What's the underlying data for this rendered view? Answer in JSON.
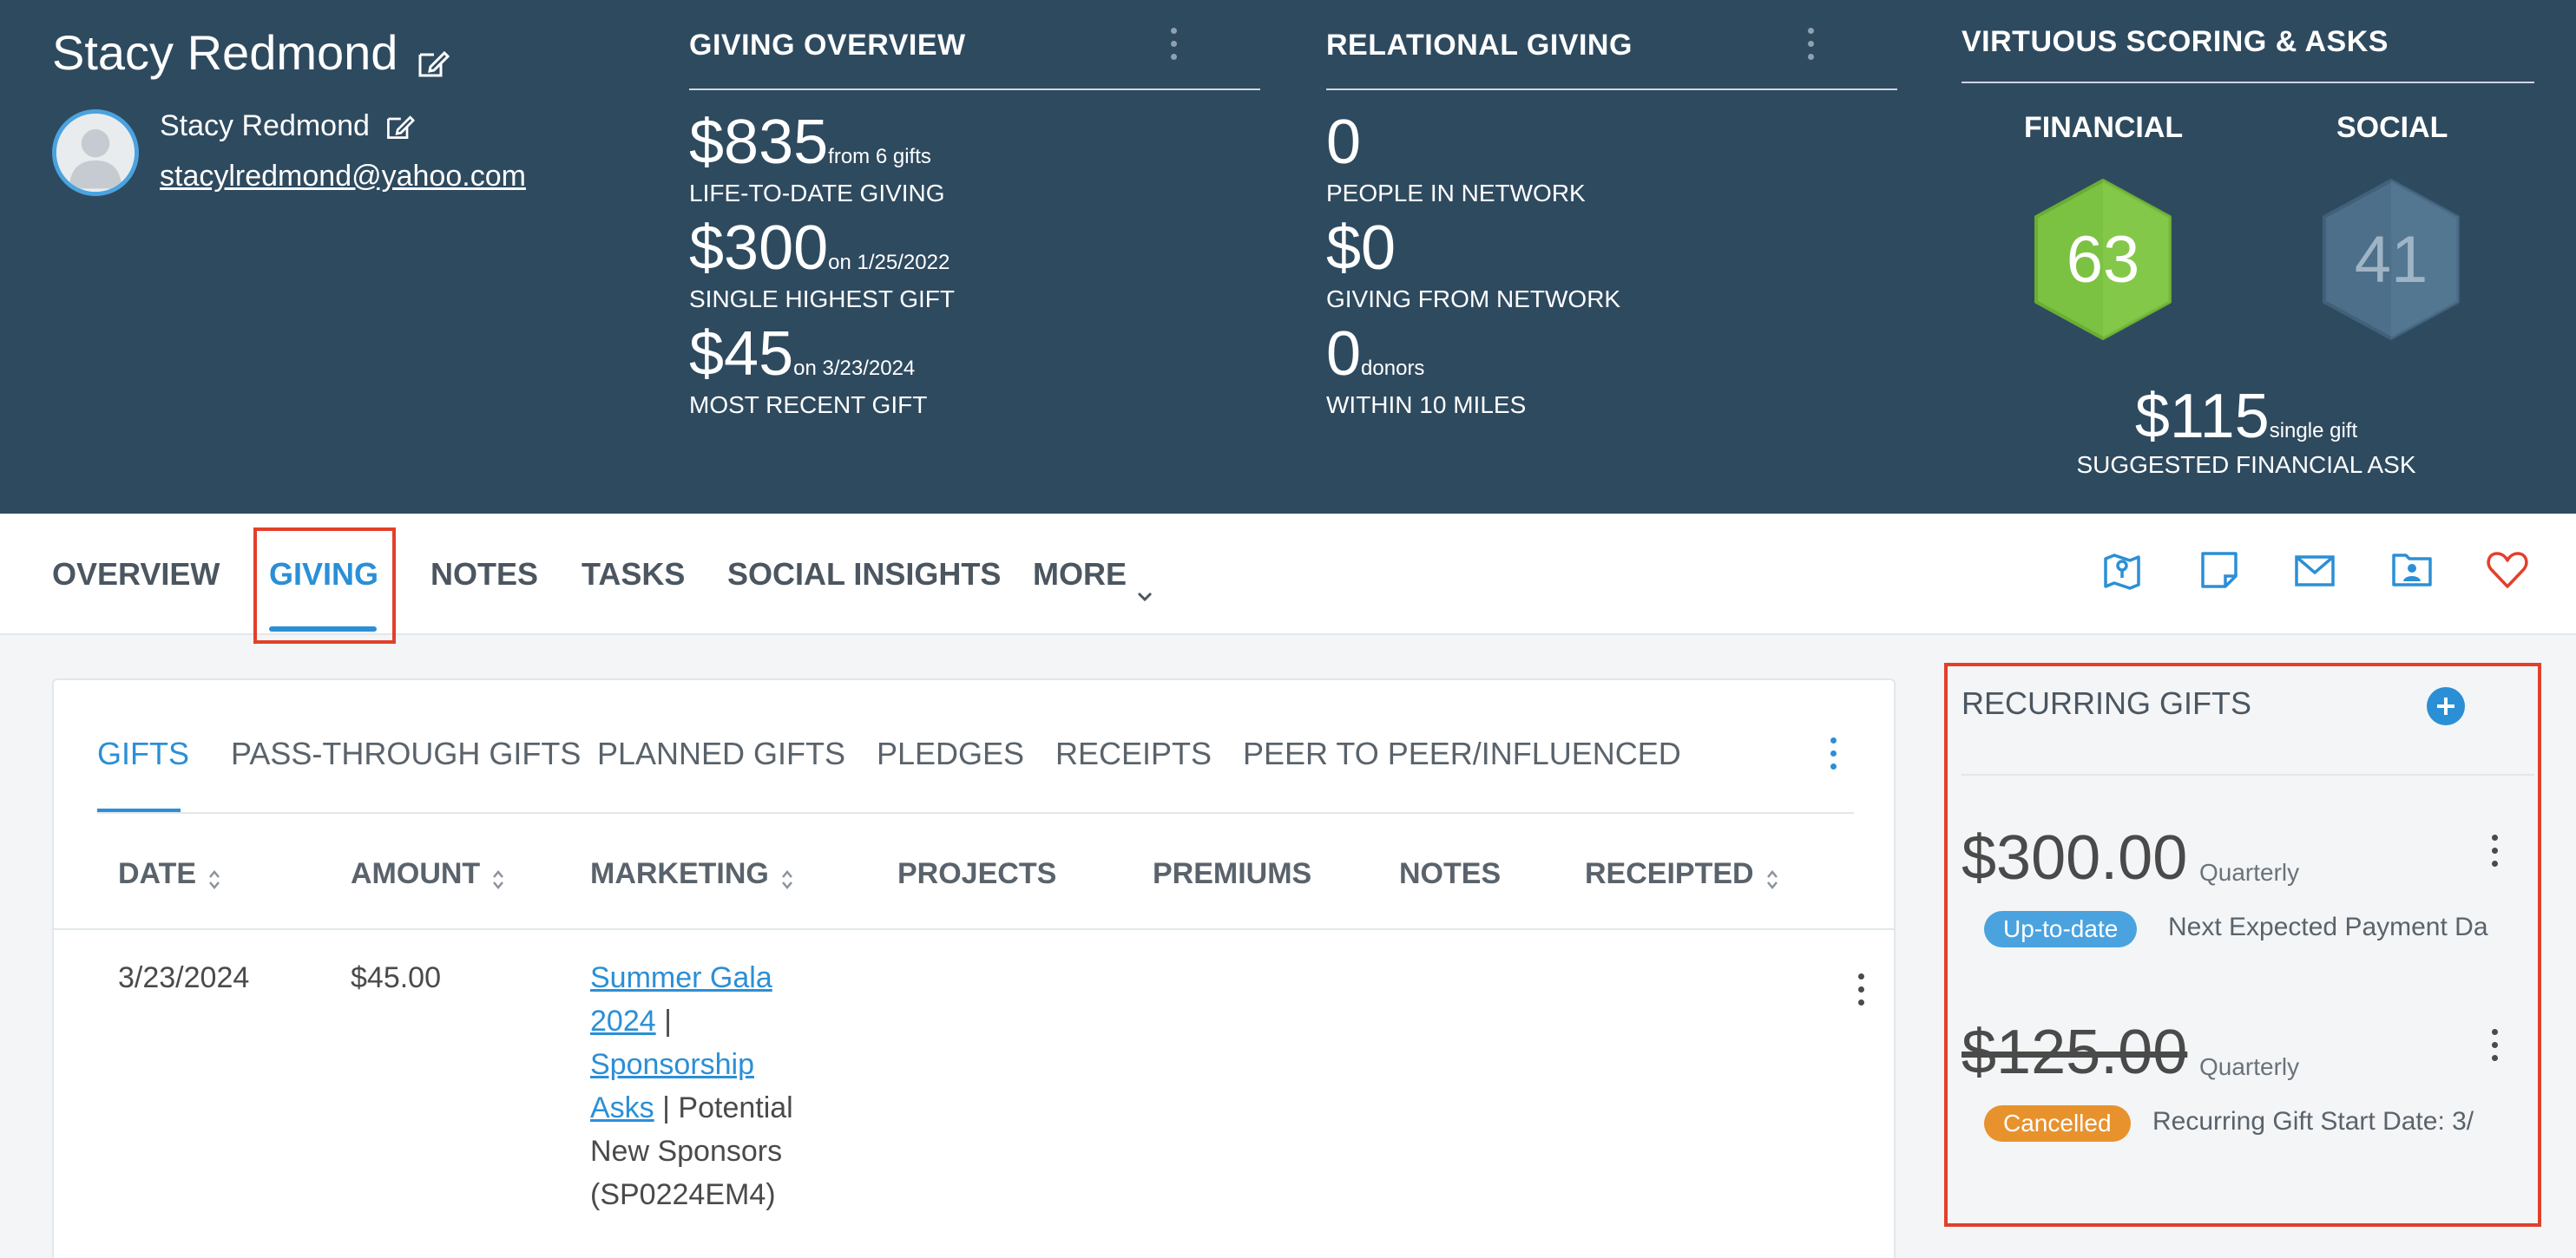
{
  "profile": {
    "name": "Stacy Redmond",
    "contact_name": "Stacy Redmond",
    "email": "stacylredmond@yahoo.com"
  },
  "giving_overview": {
    "title": "GIVING OVERVIEW",
    "lifetime": {
      "amount": "$835",
      "detail": "from 6 gifts",
      "label": "LIFE-TO-DATE GIVING"
    },
    "highest": {
      "amount": "$300",
      "detail": "on 1/25/2022",
      "label": "SINGLE HIGHEST GIFT"
    },
    "recent": {
      "amount": "$45",
      "detail": "on 3/23/2024",
      "label": "MOST RECENT GIFT"
    }
  },
  "relational_giving": {
    "title": "RELATIONAL GIVING",
    "network": {
      "amount": "0",
      "label": "PEOPLE IN NETWORK"
    },
    "network_giving": {
      "amount": "$0",
      "label": "GIVING FROM NETWORK"
    },
    "nearby": {
      "amount": "0",
      "detail": "donors",
      "label": "WITHIN 10 MILES"
    }
  },
  "scoring": {
    "title": "VIRTUOUS SCORING & ASKS",
    "financial_label": "FINANCIAL",
    "financial_score": "63",
    "social_label": "SOCIAL",
    "social_score": "41",
    "ask_amount": "$115",
    "ask_detail": "single gift",
    "ask_label": "SUGGESTED FINANCIAL ASK",
    "colors": {
      "financial": "#7bc142",
      "social": "#4d6f89"
    }
  },
  "nav": {
    "items": [
      "OVERVIEW",
      "GIVING",
      "NOTES",
      "TASKS",
      "SOCIAL INSIGHTS",
      "MORE"
    ],
    "active": "GIVING",
    "icons": [
      "map-pin-icon",
      "note-icon",
      "mail-icon",
      "contact-card-icon",
      "heart-icon"
    ]
  },
  "gifts": {
    "tabs": [
      "GIFTS",
      "PASS-THROUGH GIFTS",
      "PLANNED GIFTS",
      "PLEDGES",
      "RECEIPTS",
      "PEER TO PEER/INFLUENCED"
    ],
    "columns": [
      "DATE",
      "AMOUNT",
      "MARKETING",
      "PROJECTS",
      "PREMIUMS",
      "NOTES",
      "RECEIPTED"
    ],
    "row": {
      "date": "3/23/2024",
      "amount": "$45.00",
      "link1": "Summer Gala",
      "link1b": "2024",
      "sep1": " |",
      "link2": "Sponsorship",
      "link2b": "Asks",
      "rest1": " | Potential",
      "rest2": "New Sponsors",
      "rest3": "(SP0224EM4)"
    }
  },
  "recurring": {
    "title": "RECURRING GIFTS",
    "items": [
      {
        "amount": "$300.00",
        "frequency": "Quarterly",
        "status": "Up-to-date",
        "note": "Next Expected Payment Da",
        "status_color": "#4aa3df"
      },
      {
        "amount": "$125.00",
        "frequency": "Quarterly",
        "status": "Cancelled",
        "note": "Recurring Gift Start Date: 3/",
        "status_color": "#e8922d"
      }
    ]
  }
}
